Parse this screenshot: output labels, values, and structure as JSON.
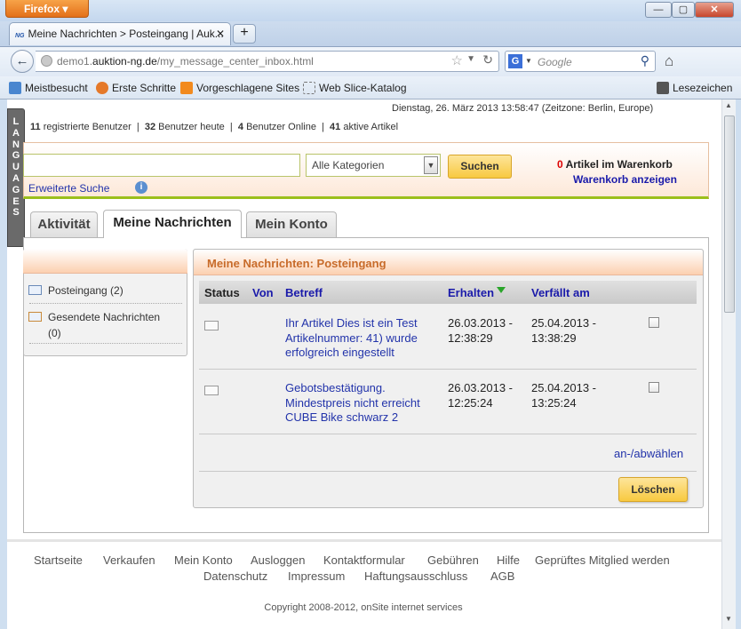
{
  "browser": {
    "app_button": "Firefox",
    "tab_title": "Meine Nachrichten > Posteingang | Auk...",
    "tab_favicon_text": "NG",
    "url_host": "demo1.auktion-ng.de",
    "url_prefix": "demo1.",
    "url_domain": "auktion-ng.de",
    "url_path": "/my_message_center_inbox.html",
    "search_engine": "G",
    "search_placeholder": "Google",
    "bookmarks": [
      "Meistbesucht",
      "Erste Schritte",
      "Vorgeschlagene Sites",
      "Web Slice-Katalog"
    ],
    "bookmarks_right": "Lesezeichen"
  },
  "languages_tab": "LANGUAGES",
  "header": {
    "datetime": "Dienstag, 26. März 2013 13:58:47 (Zeitzone: Berlin, Europe)",
    "stats": [
      {
        "num": "11",
        "label": "registrierte Benutzer"
      },
      {
        "num": "32",
        "label": "Benutzer heute"
      },
      {
        "num": "4",
        "label": "Benutzer Online"
      },
      {
        "num": "41",
        "label": "aktive Artikel"
      }
    ]
  },
  "search": {
    "query": "",
    "category": "Alle Kategorien",
    "button": "Suchen",
    "advanced": "Erweiterte Suche",
    "info_icon": "i"
  },
  "cart": {
    "count": "0",
    "label": "Artikel im Warenkorb",
    "link": "Warenkorb anzeigen"
  },
  "tabs": [
    "Aktivität",
    "Meine Nachrichten",
    "Mein Konto"
  ],
  "sidebar": {
    "items": [
      {
        "label": "Posteingang (2)"
      },
      {
        "label": "Gesendete Nachrichten",
        "sub": "(0)"
      }
    ]
  },
  "inbox": {
    "title": "Meine Nachrichten: Posteingang",
    "columns": [
      "Status",
      "Von",
      "Betreff",
      "Erhalten",
      "Verfällt am"
    ],
    "messages": [
      {
        "subject": [
          "Ihr Artikel Dies ist ein Test",
          "Artikelnummer: 41) wurde",
          "erfolgreich eingestellt"
        ],
        "received": [
          "26.03.2013 -",
          "12:38:29"
        ],
        "expires": [
          "25.04.2013 -",
          "13:38:29"
        ]
      },
      {
        "subject": [
          "Gebotsbestätigung.",
          "Mindestpreis nicht erreicht",
          "CUBE Bike schwarz 2"
        ],
        "received": [
          "26.03.2013 -",
          "12:25:24"
        ],
        "expires": [
          "25.04.2013 -",
          "13:25:24"
        ]
      }
    ],
    "toggle_link": "an-/abwählen",
    "delete_button": "Löschen"
  },
  "footer": {
    "row1": [
      "Startseite",
      "Verkaufen",
      "Mein Konto",
      "Ausloggen",
      "Kontaktformular",
      "Gebühren",
      "Hilfe",
      "Geprüftes Mitglied werden"
    ],
    "row2": [
      "Datenschutz",
      "Impressum",
      "Haftungsausschluss",
      "AGB"
    ],
    "copyright": "Copyright 2008-2012, onSite internet services"
  },
  "colors": {
    "accent_orange": "#c86b2a",
    "link_blue": "#2233aa",
    "button_yellow": "#f8c940",
    "green_bar": "#9bbf1c",
    "alert_red": "#dd0000"
  }
}
